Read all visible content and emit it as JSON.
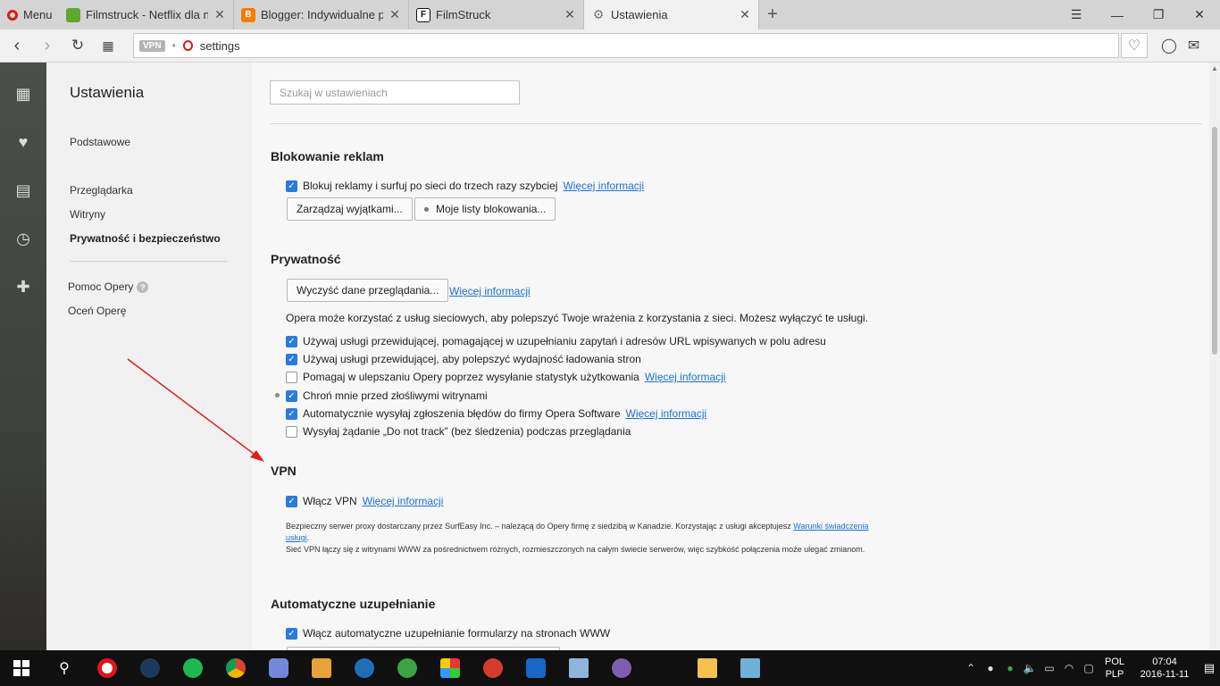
{
  "browser": {
    "menu_label": "Menu",
    "tabs": [
      {
        "title": "Filmstruck - Netflix dla nisz",
        "favicon_color": "#5fa82e",
        "active": false
      },
      {
        "title": "Blogger: Indywidualne prze",
        "favicon_color": "#f57d00",
        "active": false
      },
      {
        "title": "FilmStruck",
        "favicon_color": "#111111",
        "active": false
      },
      {
        "title": "Ustawienia",
        "favicon_color": "#777777",
        "active": true
      }
    ],
    "new_tab": "+",
    "vpn_badge": "VPN",
    "url": "settings"
  },
  "sidenav": {
    "title": "Ustawienia",
    "items": [
      "Podstawowe",
      "Przeglądarka",
      "Witryny",
      "Prywatność i bezpieczeństwo"
    ],
    "help": "Pomoc Opery",
    "rate": "Oceń Operę"
  },
  "search": {
    "placeholder": "Szukaj w ustawieniach"
  },
  "sections": {
    "ads": {
      "title": "Blokowanie reklam",
      "block_label": "Blokuj reklamy i surfuj po sieci do trzech razy szybciej",
      "more": "Więcej informacji",
      "manage_btn": "Zarządzaj wyjątkami...",
      "lists_btn": "Moje listy blokowania..."
    },
    "privacy": {
      "title": "Prywatność",
      "clear_btn": "Wyczyść dane przeglądania...",
      "more": "Więcej informacji",
      "desc": "Opera może korzystać z usług sieciowych, aby polepszyć Twoje wrażenia z korzystania z sieci. Możesz wyłączyć te usługi.",
      "opt1": "Używaj usługi przewidującej, pomagającej w uzupełnianiu zapytań i adresów URL wpisywanych w polu adresu",
      "opt2": "Używaj usługi przewidującej, aby polepszyć wydajność ładowania stron",
      "opt3": "Pomagaj w ulepszaniu Opery poprzez wysyłanie statystyk użytkowania",
      "opt4": "Chroń mnie przed złośliwymi witrynami",
      "opt5": "Automatycznie wysyłaj zgłoszenia błędów do firmy Opera Software",
      "opt6": "Wysyłaj żądanie „Do not track” (bez śledzenia) podczas przeglądania"
    },
    "vpn": {
      "title": "VPN",
      "enable": "Włącz VPN",
      "more": "Więcej informacji",
      "note1": "Bezpieczny serwer proxy dostarczany przez SurfEasy Inc. – należącą do Opery firmę z siedzibą w Kanadzie. Korzystając z usługi akceptujesz",
      "terms": "Warunki świadczenia usługi",
      "note2": "Sieć VPN łączy się z witrynami WWW za pośrednictwem różnych, rozmieszczonych na całym świecie serwerów, więc szybkość połączenia może ulegać zmianom."
    },
    "autofill": {
      "title": "Automatyczne uzupełnianie",
      "enable": "Włącz automatyczne uzupełnianie formularzy na stronach WWW"
    }
  },
  "taskbar": {
    "lang1": "POL",
    "lang2": "PLP",
    "time": "07:04",
    "date": "2016-11-11"
  }
}
